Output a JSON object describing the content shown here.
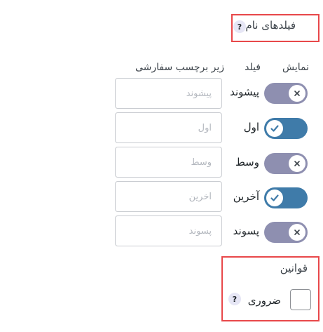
{
  "section": {
    "title": "فیلدهای نام",
    "help_symbol": "?"
  },
  "columns": {
    "show": "نمایش",
    "field": "فیلد",
    "sublabel": "زیر برچسب سفارشی"
  },
  "rows": [
    {
      "label": "پیشوند",
      "placeholder": "پیشوند",
      "enabled": false
    },
    {
      "label": "اول",
      "placeholder": "اول",
      "enabled": true
    },
    {
      "label": "وسط",
      "placeholder": "وسط",
      "enabled": false
    },
    {
      "label": "آخرین",
      "placeholder": "آخرین",
      "enabled": true
    },
    {
      "label": "پسوند",
      "placeholder": "پسوند",
      "enabled": false
    }
  ],
  "rules": {
    "title": "قوانین",
    "required_label": "ضروری",
    "help_symbol": "?",
    "required_checked": false
  },
  "colors": {
    "toggle_on": "#3f7ba9",
    "toggle_off": "#8e8fb0",
    "highlight": "#e8484a"
  }
}
